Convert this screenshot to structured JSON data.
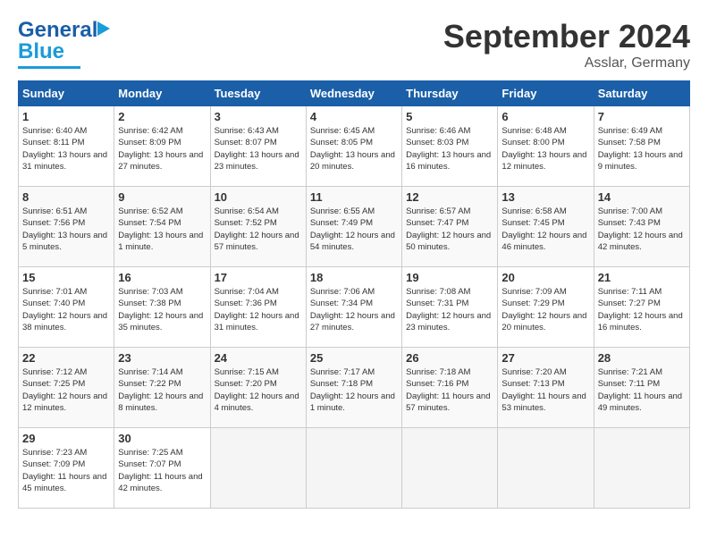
{
  "header": {
    "logo_line1": "General",
    "logo_line2": "Blue",
    "month": "September 2024",
    "location": "Asslar, Germany"
  },
  "weekdays": [
    "Sunday",
    "Monday",
    "Tuesday",
    "Wednesday",
    "Thursday",
    "Friday",
    "Saturday"
  ],
  "weeks": [
    [
      {
        "day": "1",
        "sunrise": "Sunrise: 6:40 AM",
        "sunset": "Sunset: 8:11 PM",
        "daylight": "Daylight: 13 hours and 31 minutes."
      },
      {
        "day": "2",
        "sunrise": "Sunrise: 6:42 AM",
        "sunset": "Sunset: 8:09 PM",
        "daylight": "Daylight: 13 hours and 27 minutes."
      },
      {
        "day": "3",
        "sunrise": "Sunrise: 6:43 AM",
        "sunset": "Sunset: 8:07 PM",
        "daylight": "Daylight: 13 hours and 23 minutes."
      },
      {
        "day": "4",
        "sunrise": "Sunrise: 6:45 AM",
        "sunset": "Sunset: 8:05 PM",
        "daylight": "Daylight: 13 hours and 20 minutes."
      },
      {
        "day": "5",
        "sunrise": "Sunrise: 6:46 AM",
        "sunset": "Sunset: 8:03 PM",
        "daylight": "Daylight: 13 hours and 16 minutes."
      },
      {
        "day": "6",
        "sunrise": "Sunrise: 6:48 AM",
        "sunset": "Sunset: 8:00 PM",
        "daylight": "Daylight: 13 hours and 12 minutes."
      },
      {
        "day": "7",
        "sunrise": "Sunrise: 6:49 AM",
        "sunset": "Sunset: 7:58 PM",
        "daylight": "Daylight: 13 hours and 9 minutes."
      }
    ],
    [
      {
        "day": "8",
        "sunrise": "Sunrise: 6:51 AM",
        "sunset": "Sunset: 7:56 PM",
        "daylight": "Daylight: 13 hours and 5 minutes."
      },
      {
        "day": "9",
        "sunrise": "Sunrise: 6:52 AM",
        "sunset": "Sunset: 7:54 PM",
        "daylight": "Daylight: 13 hours and 1 minute."
      },
      {
        "day": "10",
        "sunrise": "Sunrise: 6:54 AM",
        "sunset": "Sunset: 7:52 PM",
        "daylight": "Daylight: 12 hours and 57 minutes."
      },
      {
        "day": "11",
        "sunrise": "Sunrise: 6:55 AM",
        "sunset": "Sunset: 7:49 PM",
        "daylight": "Daylight: 12 hours and 54 minutes."
      },
      {
        "day": "12",
        "sunrise": "Sunrise: 6:57 AM",
        "sunset": "Sunset: 7:47 PM",
        "daylight": "Daylight: 12 hours and 50 minutes."
      },
      {
        "day": "13",
        "sunrise": "Sunrise: 6:58 AM",
        "sunset": "Sunset: 7:45 PM",
        "daylight": "Daylight: 12 hours and 46 minutes."
      },
      {
        "day": "14",
        "sunrise": "Sunrise: 7:00 AM",
        "sunset": "Sunset: 7:43 PM",
        "daylight": "Daylight: 12 hours and 42 minutes."
      }
    ],
    [
      {
        "day": "15",
        "sunrise": "Sunrise: 7:01 AM",
        "sunset": "Sunset: 7:40 PM",
        "daylight": "Daylight: 12 hours and 38 minutes."
      },
      {
        "day": "16",
        "sunrise": "Sunrise: 7:03 AM",
        "sunset": "Sunset: 7:38 PM",
        "daylight": "Daylight: 12 hours and 35 minutes."
      },
      {
        "day": "17",
        "sunrise": "Sunrise: 7:04 AM",
        "sunset": "Sunset: 7:36 PM",
        "daylight": "Daylight: 12 hours and 31 minutes."
      },
      {
        "day": "18",
        "sunrise": "Sunrise: 7:06 AM",
        "sunset": "Sunset: 7:34 PM",
        "daylight": "Daylight: 12 hours and 27 minutes."
      },
      {
        "day": "19",
        "sunrise": "Sunrise: 7:08 AM",
        "sunset": "Sunset: 7:31 PM",
        "daylight": "Daylight: 12 hours and 23 minutes."
      },
      {
        "day": "20",
        "sunrise": "Sunrise: 7:09 AM",
        "sunset": "Sunset: 7:29 PM",
        "daylight": "Daylight: 12 hours and 20 minutes."
      },
      {
        "day": "21",
        "sunrise": "Sunrise: 7:11 AM",
        "sunset": "Sunset: 7:27 PM",
        "daylight": "Daylight: 12 hours and 16 minutes."
      }
    ],
    [
      {
        "day": "22",
        "sunrise": "Sunrise: 7:12 AM",
        "sunset": "Sunset: 7:25 PM",
        "daylight": "Daylight: 12 hours and 12 minutes."
      },
      {
        "day": "23",
        "sunrise": "Sunrise: 7:14 AM",
        "sunset": "Sunset: 7:22 PM",
        "daylight": "Daylight: 12 hours and 8 minutes."
      },
      {
        "day": "24",
        "sunrise": "Sunrise: 7:15 AM",
        "sunset": "Sunset: 7:20 PM",
        "daylight": "Daylight: 12 hours and 4 minutes."
      },
      {
        "day": "25",
        "sunrise": "Sunrise: 7:17 AM",
        "sunset": "Sunset: 7:18 PM",
        "daylight": "Daylight: 12 hours and 1 minute."
      },
      {
        "day": "26",
        "sunrise": "Sunrise: 7:18 AM",
        "sunset": "Sunset: 7:16 PM",
        "daylight": "Daylight: 11 hours and 57 minutes."
      },
      {
        "day": "27",
        "sunrise": "Sunrise: 7:20 AM",
        "sunset": "Sunset: 7:13 PM",
        "daylight": "Daylight: 11 hours and 53 minutes."
      },
      {
        "day": "28",
        "sunrise": "Sunrise: 7:21 AM",
        "sunset": "Sunset: 7:11 PM",
        "daylight": "Daylight: 11 hours and 49 minutes."
      }
    ],
    [
      {
        "day": "29",
        "sunrise": "Sunrise: 7:23 AM",
        "sunset": "Sunset: 7:09 PM",
        "daylight": "Daylight: 11 hours and 45 minutes."
      },
      {
        "day": "30",
        "sunrise": "Sunrise: 7:25 AM",
        "sunset": "Sunset: 7:07 PM",
        "daylight": "Daylight: 11 hours and 42 minutes."
      },
      {
        "day": "",
        "sunrise": "",
        "sunset": "",
        "daylight": ""
      },
      {
        "day": "",
        "sunrise": "",
        "sunset": "",
        "daylight": ""
      },
      {
        "day": "",
        "sunrise": "",
        "sunset": "",
        "daylight": ""
      },
      {
        "day": "",
        "sunrise": "",
        "sunset": "",
        "daylight": ""
      },
      {
        "day": "",
        "sunrise": "",
        "sunset": "",
        "daylight": ""
      }
    ]
  ]
}
